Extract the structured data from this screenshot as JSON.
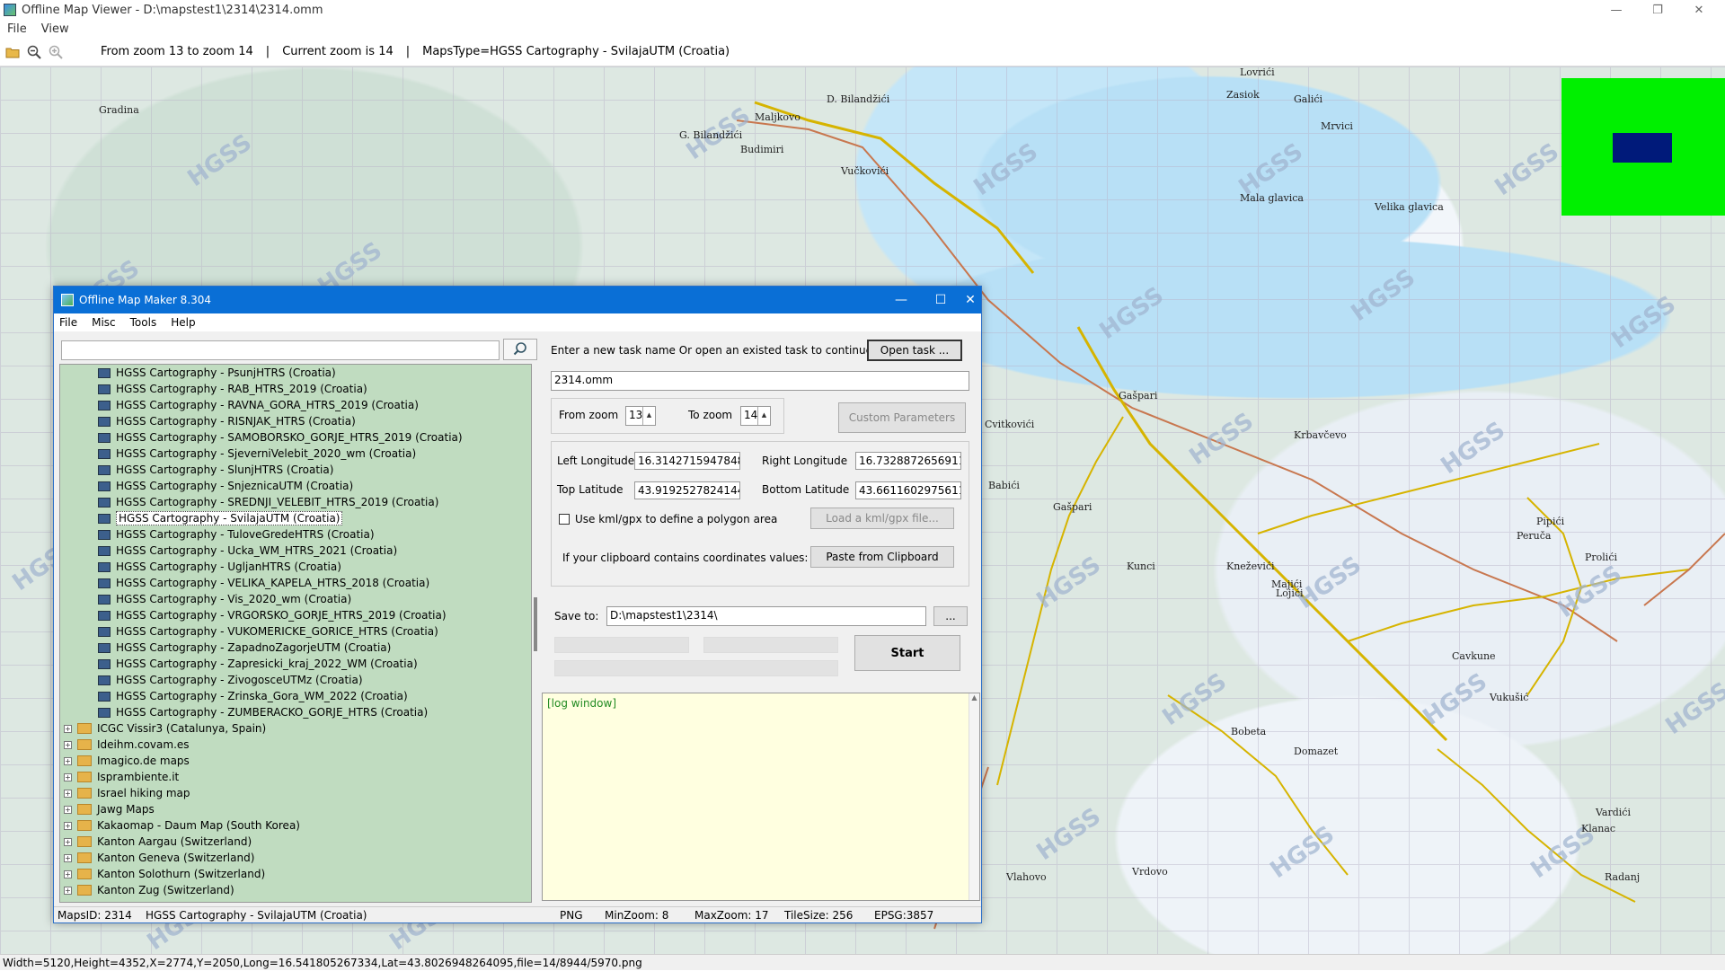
{
  "app": {
    "title": "Offline Map Viewer - D:\\mapstest1\\2314\\2314.omm",
    "menu": [
      "File",
      "View"
    ],
    "window_controls": [
      "—",
      "❐",
      "✕"
    ]
  },
  "toolbar": {
    "icons": [
      "open-folder-icon",
      "zoom-out-icon",
      "zoom-in-icon"
    ],
    "zoom_range": "From zoom 13 to zoom 14",
    "sep1": "|",
    "current_zoom": "Current zoom is 14",
    "sep2": "|",
    "maps_type": "MapsType=HGSS Cartography - SvilajaUTM (Croatia)"
  },
  "map": {
    "watermark": "HGSS",
    "place_labels": [
      "Maljkovo",
      "D. Bilandžići",
      "Lovrići",
      "Zasiok",
      "Galići",
      "Mrvici",
      "G. Bilandžići",
      "Budimiri",
      "Vučkovići",
      "Mala glavica",
      "Velika glavica",
      "Gašpari",
      "Kunci",
      "Kneževići",
      "Majići",
      "Lojići",
      "Pipići",
      "Peruča",
      "Prolići",
      "Bobeta",
      "Domazet",
      "Vukušić",
      "Cavkune",
      "Cvitkovići",
      "Babići",
      "Gašpari",
      "Vardići",
      "Klanac",
      "Radanj",
      "Vrdovo",
      "Vlahovo",
      "Gradina",
      "Krbavčevo"
    ],
    "overview_colors": {
      "background": "#00f000",
      "viewport": "#001a7a"
    }
  },
  "status_bar": "Width=5120,Height=4352,X=2774,Y=2050,Long=16.541805267334,Lat=43.8026948264095,file=14/8944/5970.png",
  "dialog": {
    "title": "Offline Map Maker 8.304",
    "menu": [
      "File",
      "Misc",
      "Tools",
      "Help"
    ],
    "window_controls": [
      "—",
      "☐",
      "✕"
    ],
    "search": {
      "value": "",
      "icon": "search-icon"
    },
    "tree_items": [
      "HGSS Cartography - PsunjHTRS (Croatia)",
      "HGSS Cartography - RAB_HTRS_2019 (Croatia)",
      "HGSS Cartography - RAVNA_GORA_HTRS_2019 (Croatia)",
      "HGSS Cartography - RISNJAK_HTRS (Croatia)",
      "HGSS Cartography - SAMOBORSKO_GORJE_HTRS_2019 (Croatia)",
      "HGSS Cartography - SjeverniVelebit_2020_wm (Croatia)",
      "HGSS Cartography - SlunjHTRS (Croatia)",
      "HGSS Cartography - SnjeznicaUTM (Croatia)",
      "HGSS Cartography - SREDNJI_VELEBIT_HTRS_2019 (Croatia)",
      "HGSS Cartography - SvilajaUTM (Croatia)",
      "HGSS Cartography - TuloveGredeHTRS (Croatia)",
      "HGSS Cartography - Ucka_WM_HTRS_2021 (Croatia)",
      "HGSS Cartography - UgljanHTRS (Croatia)",
      "HGSS Cartography - VELIKA_KAPELA_HTRS_2018 (Croatia)",
      "HGSS Cartography - Vis_2020_wm (Croatia)",
      "HGSS Cartography - VRGORSKO_GORJE_HTRS_2019 (Croatia)",
      "HGSS Cartography - VUKOMERICKE_GORICE_HTRS (Croatia)",
      "HGSS Cartography - ZapadnoZagorjeUTM (Croatia)",
      "HGSS Cartography - Zapresicki_kraj_2022_WM (Croatia)",
      "HGSS Cartography - ZivogosceUTMz (Croatia)",
      "HGSS Cartography - Zrinska_Gora_WM_2022 (Croatia)",
      "HGSS Cartography - ZUMBERACKO_GORJE_HTRS (Croatia)"
    ],
    "selected_item": "HGSS Cartography - SvilajaUTM (Croatia)",
    "tree_folders": [
      "ICGC Vissir3 (Catalunya, Spain)",
      "Ideihm.covam.es",
      "Imagico.de maps",
      "Isprambiente.it",
      "Israel hiking map",
      "Jawg Maps",
      "Kakaomap - Daum Map (South Korea)",
      "Kanton Aargau (Switzerland)",
      "Kanton Geneva (Switzerland)",
      "Kanton Solothurn (Switzerland)",
      "Kanton Zug (Switzerland)"
    ],
    "task_prompt": "Enter a new task name Or open an existed task to continue:",
    "open_task_label": "Open task ...",
    "task_name": "2314.omm",
    "from_zoom_label": "From zoom",
    "from_zoom": "13",
    "to_zoom_label": "To zoom",
    "to_zoom": "14",
    "custom_params_label": "Custom Parameters",
    "left_lon_label": "Left Longitude",
    "left_lon": "16.3142715947848",
    "right_lon_label": "Right Longitude",
    "right_lon": "16.7328872656911",
    "top_lat_label": "Top Latitude",
    "top_lat": "43.9192527824144",
    "bottom_lat_label": "Bottom Latitude",
    "bottom_lat": "43.6611602975611",
    "kml_checkbox_label": "Use kml/gpx to define a polygon area",
    "kml_checked": false,
    "load_kml_label": "Load a kml/gpx file...",
    "clipboard_label": "If your clipboard contains coordinates values:",
    "paste_label": "Paste from Clipboard",
    "save_to_label": "Save to:",
    "save_to": "D:\\mapstest1\\2314\\",
    "browse_label": "...",
    "start_label": "Start",
    "log_text": "[log window]",
    "status": {
      "maps_id": "MapsID: 2314",
      "maps_name": "HGSS Cartography - SvilajaUTM (Croatia)",
      "format": "PNG",
      "min_zoom": "MinZoom: 8",
      "max_zoom": "MaxZoom: 17",
      "tile_size": "TileSize: 256",
      "epsg": "EPSG:3857"
    }
  }
}
